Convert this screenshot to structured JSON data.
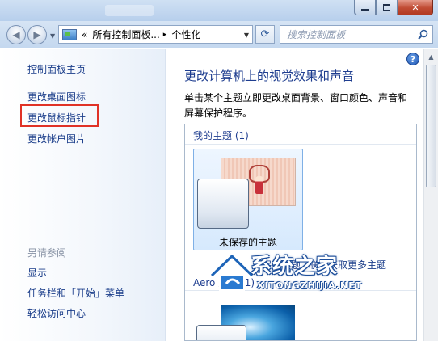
{
  "window": {
    "controls": {
      "minimize": "minimize",
      "maximize": "maximize",
      "close": "close"
    }
  },
  "address_bar": {
    "overflow": "«",
    "segments": [
      "所有控制面板...",
      "个性化"
    ],
    "separator": "▸"
  },
  "search": {
    "placeholder": "搜索控制面板"
  },
  "sidebar": {
    "home": "控制面板主页",
    "links": [
      "更改桌面图标",
      "更改鼠标指针",
      "更改帐户图片"
    ],
    "highlighted_link": "更改鼠标指针",
    "highlight_color": "#e03226",
    "see_also_title": "另请参阅",
    "see_also": [
      "显示",
      "任务栏和「开始」菜单",
      "轻松访问中心"
    ]
  },
  "main": {
    "help": "?",
    "title": "更改计算机上的视觉效果和声音",
    "description": "单击某个主题立即更改桌面背景、窗口颜色、声音和屏幕保护程序。",
    "my_themes_title": "我的主题 (1)",
    "unsaved_theme": "未保存的主题",
    "save_theme_link": "保存主题",
    "online_themes_link": "联机获取更多主题",
    "aero_themes_title": "Aero 主题 (1)"
  },
  "watermark": {
    "text": "系统之家",
    "url": "XITONGZHIJIA.NET"
  },
  "colors": {
    "link": "#1a3d8a",
    "title": "#1e3d8f",
    "accent_red": "#e03226"
  },
  "icons": [
    "back-icon",
    "forward-icon",
    "control-panel-icon",
    "refresh-icon",
    "search-icon",
    "help-icon"
  ]
}
